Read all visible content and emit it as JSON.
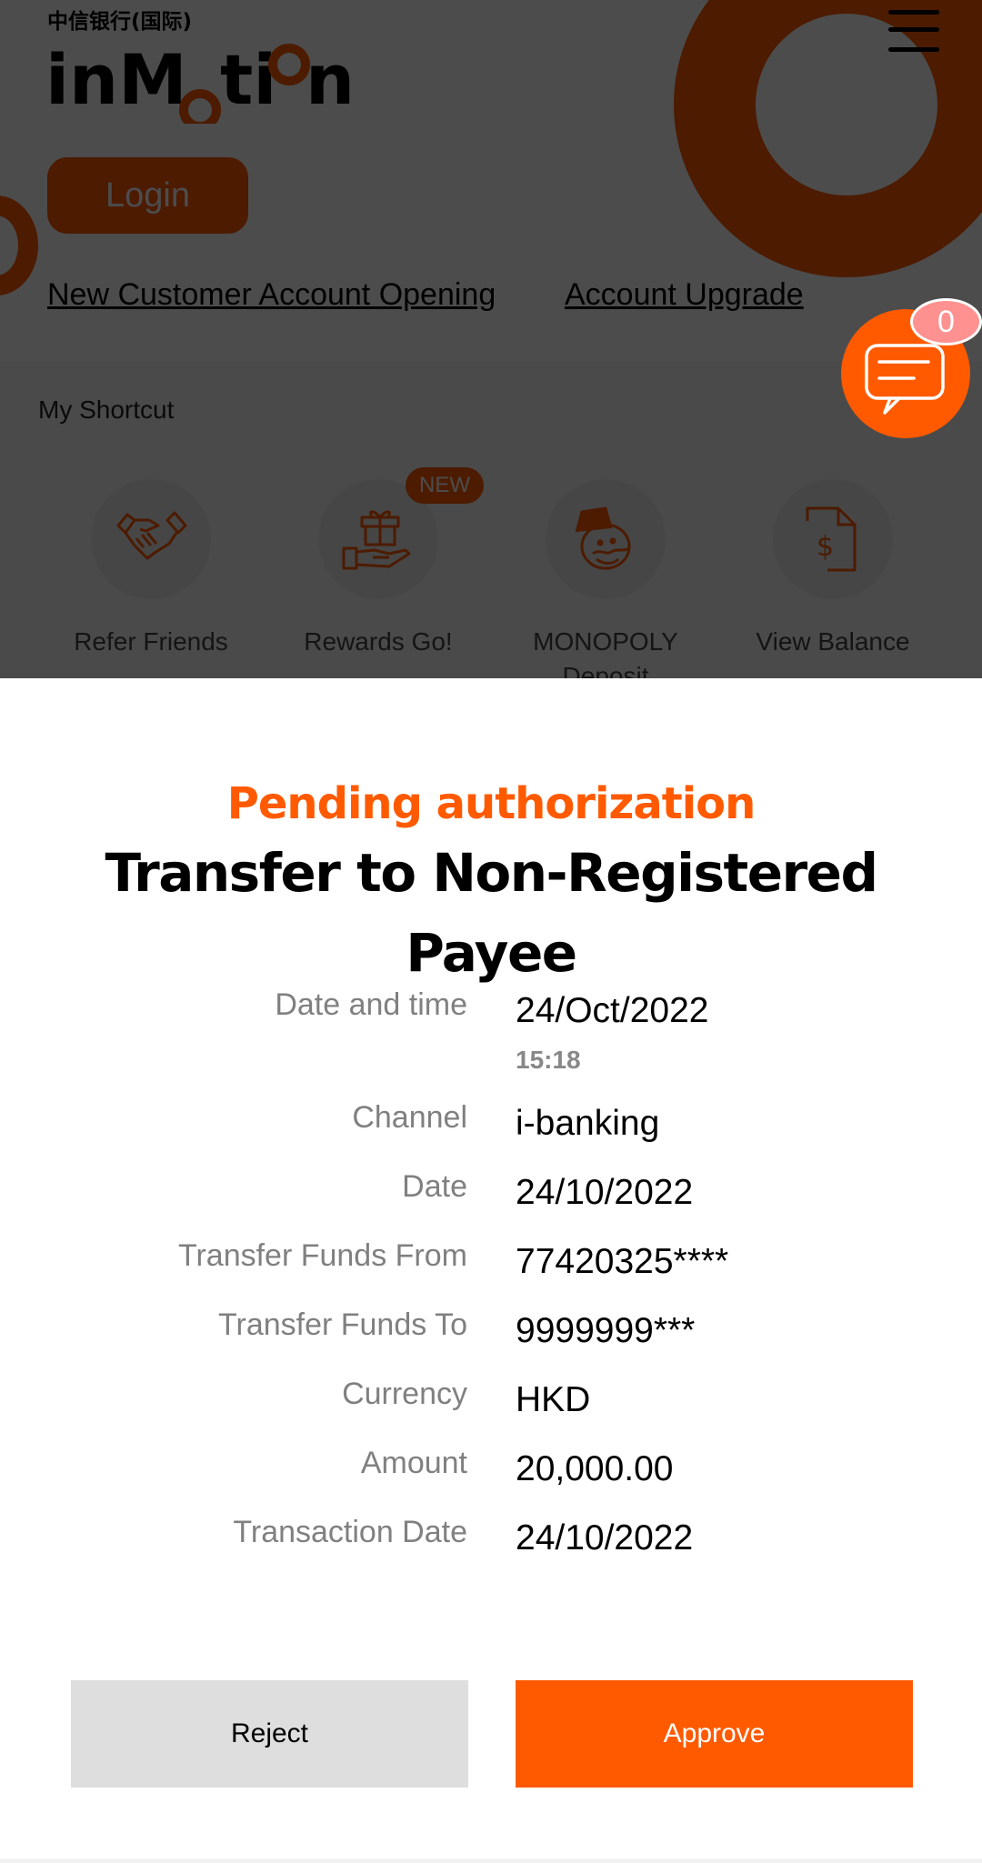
{
  "header": {
    "brand_chinese": "中信银行(国际)",
    "brand_logo": "inMotion",
    "menu_icon": "hamburger-menu-icon",
    "login_label": "Login",
    "links": [
      "New Customer Account Opening",
      "Account Upgrade"
    ]
  },
  "chat": {
    "icon": "chat-bubble-icon",
    "badge_count": "0"
  },
  "shortcut": {
    "title": "My Shortcut",
    "items": [
      {
        "label": "Refer Friends",
        "icon": "handshake-icon",
        "badge": ""
      },
      {
        "label": "Rewards Go!",
        "icon": "gift-hand-icon",
        "badge": "NEW"
      },
      {
        "label": "MONOPOLY Deposit",
        "icon": "monopoly-man-icon",
        "badge": ""
      },
      {
        "label": "View Balance",
        "icon": "dollar-document-icon",
        "badge": ""
      }
    ]
  },
  "sheet": {
    "status": "Pending authorization",
    "title": "Transfer to Non-Registered Payee",
    "details": [
      {
        "label": "Date and time",
        "value": "24/Oct/2022",
        "sub": "15:18"
      },
      {
        "label": "Channel",
        "value": "i-banking"
      },
      {
        "label": "Date",
        "value": "24/10/2022"
      },
      {
        "label": "Transfer Funds From",
        "value": "77420325****"
      },
      {
        "label": "Transfer Funds To",
        "value": "9999999***"
      },
      {
        "label": "Currency",
        "value": "HKD"
      },
      {
        "label": "Amount",
        "value": "20,000.00"
      },
      {
        "label": "Transaction Date",
        "value": "24/10/2022"
      }
    ],
    "reject_label": "Reject",
    "approve_label": "Approve"
  },
  "colors": {
    "brand_orange": "#ff5a00",
    "reject_bg": "#dedede",
    "label_gray": "#808080",
    "badge_pink": "#ff9191"
  }
}
